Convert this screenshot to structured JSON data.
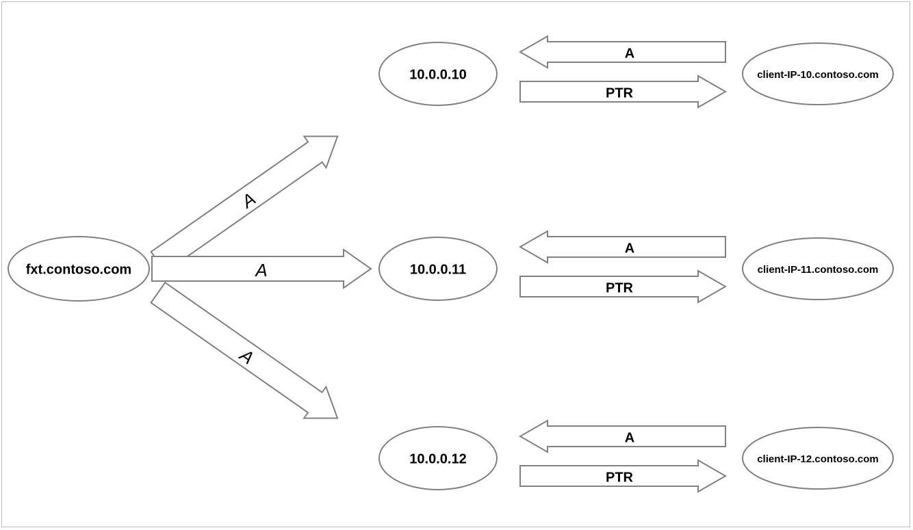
{
  "diagram": {
    "source": "fxt.contoso.com",
    "ips": [
      "10.0.0.10",
      "10.0.0.11",
      "10.0.0.12"
    ],
    "clients": [
      "client-IP-10.contoso.com",
      "client-IP-11.contoso.com",
      "client-IP-12.contoso.com"
    ],
    "record_A": "A",
    "record_PTR": "PTR"
  }
}
